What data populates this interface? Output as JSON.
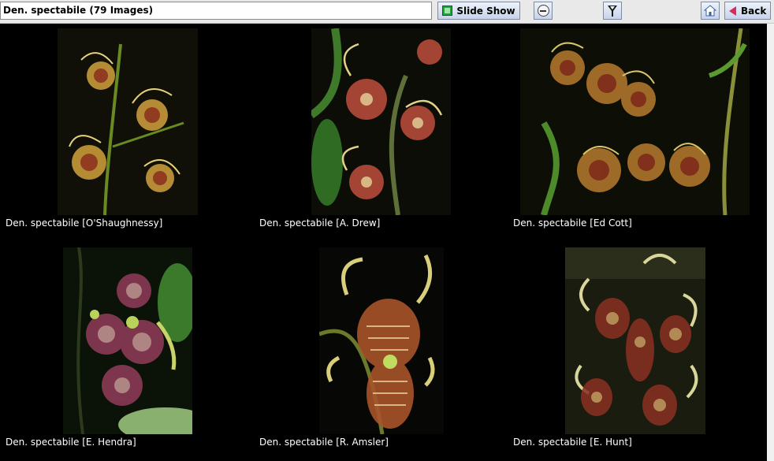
{
  "header": {
    "title": "Den. spectabile (79 Images)",
    "slideshow_label": "Slide Show",
    "back_label": "Back"
  },
  "icons": {
    "slideshow": "slideshow-icon",
    "zoom_out": "zoom-out-icon",
    "filter": "filter-icon",
    "home": "home-icon",
    "back": "back-arrow-icon"
  },
  "gallery": {
    "items": [
      {
        "caption": "Den. spectabile [O'Shaughnessy]"
      },
      {
        "caption": "Den. spectabile [A. Drew]"
      },
      {
        "caption": "Den. spectabile [Ed Cott]"
      },
      {
        "caption": "Den. spectabile [E. Hendra]"
      },
      {
        "caption": "Den. spectabile [R. Amsler]"
      },
      {
        "caption": "Den. spectabile [E. Hunt]"
      }
    ]
  },
  "colors": {
    "background": "#000000",
    "caption_text": "#ffffff",
    "toolbar": "#e9e9e9",
    "back_arrow": "#d92b5a",
    "slideshow_icon": "#1ea53a"
  }
}
